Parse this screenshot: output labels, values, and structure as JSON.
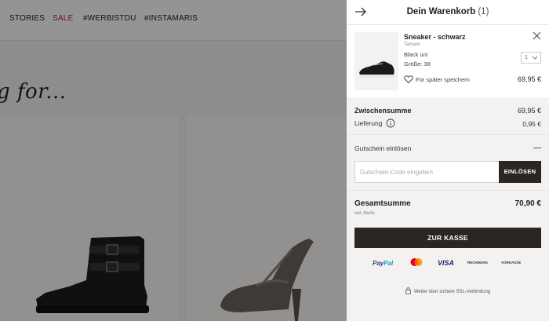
{
  "background_page": {
    "nav": [
      "STORIES",
      "SALE",
      "#WERBISTDU",
      "#INSTAMARIS"
    ],
    "headline": "g for..."
  },
  "cart": {
    "title": "Dein Warenkorb",
    "count": "(1)",
    "item": {
      "name": "Sneaker - schwarz",
      "brand": "Tamaris",
      "color": "Black uni",
      "size": "Größe: 38",
      "save_later": "Für später speichern",
      "price": "69,95 €",
      "quantity": "1"
    },
    "subtotal_label": "Zwischensumme",
    "subtotal_value": "69,95 €",
    "shipping_label": "Lieferung",
    "shipping_value": "0,95 €",
    "coupon_label": "Gutschein einlösen",
    "coupon_placeholder": "Gutschein-Code eingeben",
    "coupon_button": "EINLÖSEN",
    "total_label": "Gesamtsumme",
    "total_value": "70,90 €",
    "vat_note": "inkl. MwSt.",
    "checkout_button": "ZUR KASSE",
    "payments": {
      "paypal_a": "Pay",
      "paypal_b": "Pal",
      "visa": "VISA",
      "rechnung": "RECHNUNG",
      "vorkasse": "VORKASSE"
    },
    "ssl_note": "Weiter über sichere SSL-Verbindung"
  }
}
